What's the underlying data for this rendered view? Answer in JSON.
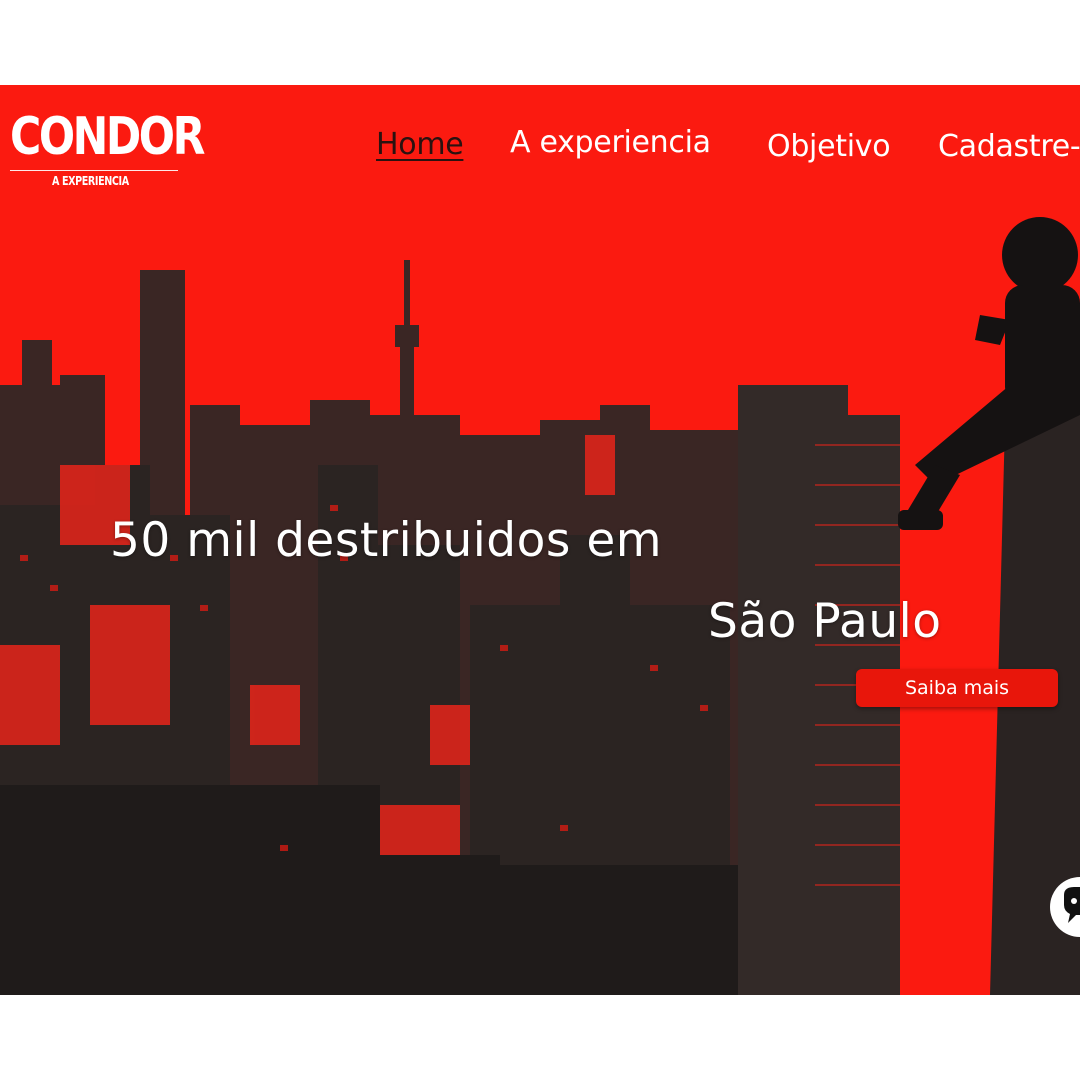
{
  "logo": {
    "word": "CONDOR",
    "subtitle": "A EXPERIENCIA"
  },
  "nav": {
    "items": [
      {
        "label": "Home",
        "active": true
      },
      {
        "label": "A experiencia",
        "active": false
      },
      {
        "label": "Objetivo",
        "active": false
      },
      {
        "label": "Cadastre-se",
        "active": false
      }
    ]
  },
  "hero": {
    "headline_line1": "50 mil destribuidos em",
    "headline_line2": "São Paulo",
    "cta_label": "Saiba mais"
  },
  "colors": {
    "hero_red": "#fb1a10",
    "button_red": "#e8160b",
    "building_dark": "#2b2422",
    "active_nav": "#2a1210"
  },
  "icons": {
    "chat": "chat-bubble-icon"
  }
}
